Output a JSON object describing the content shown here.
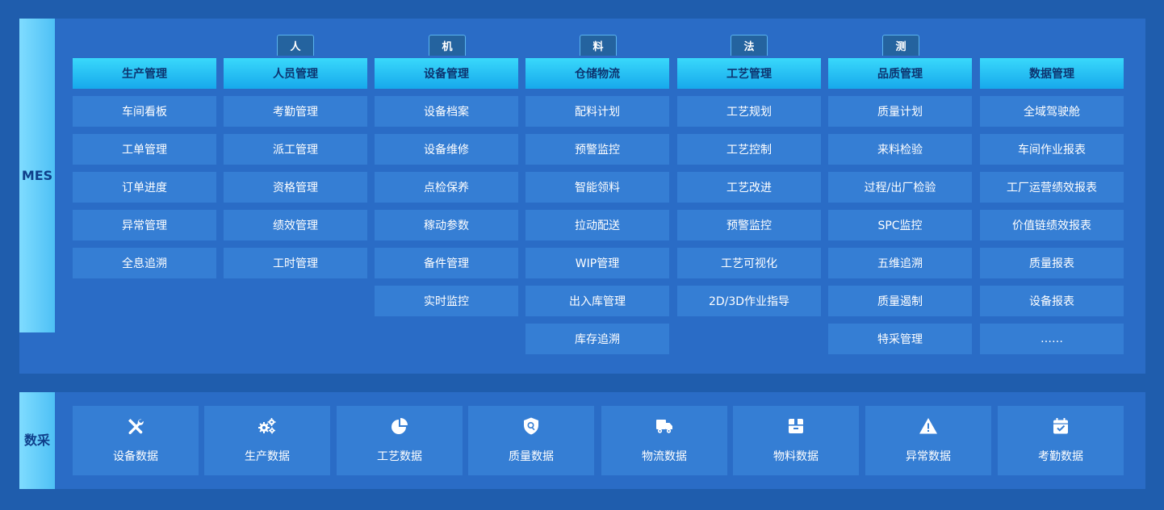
{
  "mes": {
    "label": "MES",
    "tags": [
      "人",
      "机",
      "料",
      "法",
      "测"
    ],
    "columns": [
      {
        "header": "生产管理",
        "items": [
          "车间看板",
          "工单管理",
          "订单进度",
          "异常管理",
          "全息追溯"
        ]
      },
      {
        "header": "人员管理",
        "items": [
          "考勤管理",
          "派工管理",
          "资格管理",
          "绩效管理",
          "工时管理"
        ]
      },
      {
        "header": "设备管理",
        "items": [
          "设备档案",
          "设备维修",
          "点检保养",
          "稼动参数",
          "备件管理",
          "实时监控"
        ]
      },
      {
        "header": "仓储物流",
        "items": [
          "配料计划",
          "预警监控",
          "智能领料",
          "拉动配送",
          "WIP管理",
          "出入库管理",
          "库存追溯"
        ]
      },
      {
        "header": "工艺管理",
        "items": [
          "工艺规划",
          "工艺控制",
          "工艺改进",
          "预警监控",
          "工艺可视化",
          "2D/3D作业指导"
        ]
      },
      {
        "header": "品质管理",
        "items": [
          "质量计划",
          "来料检验",
          "过程/出厂检验",
          "SPC监控",
          "五维追溯",
          "质量遏制",
          "特采管理"
        ]
      },
      {
        "header": "数据管理",
        "items": [
          "全域驾驶舱",
          "车间作业报表",
          "工厂运营绩效报表",
          "价值链绩效报表",
          "质量报表",
          "设备报表",
          "……"
        ]
      }
    ]
  },
  "daq": {
    "label": "数采",
    "items": [
      {
        "label": "设备数据",
        "icon": "wrench-screwdriver-icon"
      },
      {
        "label": "生产数据",
        "icon": "gears-icon"
      },
      {
        "label": "工艺数据",
        "icon": "pie-chart-icon"
      },
      {
        "label": "质量数据",
        "icon": "shield-search-icon"
      },
      {
        "label": "物流数据",
        "icon": "truck-icon"
      },
      {
        "label": "物料数据",
        "icon": "box-icon"
      },
      {
        "label": "异常数据",
        "icon": "warning-icon"
      },
      {
        "label": "考勤数据",
        "icon": "calendar-check-icon"
      }
    ]
  },
  "colors": {
    "background": "#1f5dad",
    "panel": "#2a6cc6",
    "cell": "#357ed4",
    "header": "#17a9ec",
    "side_label": "#4ec0f5"
  }
}
